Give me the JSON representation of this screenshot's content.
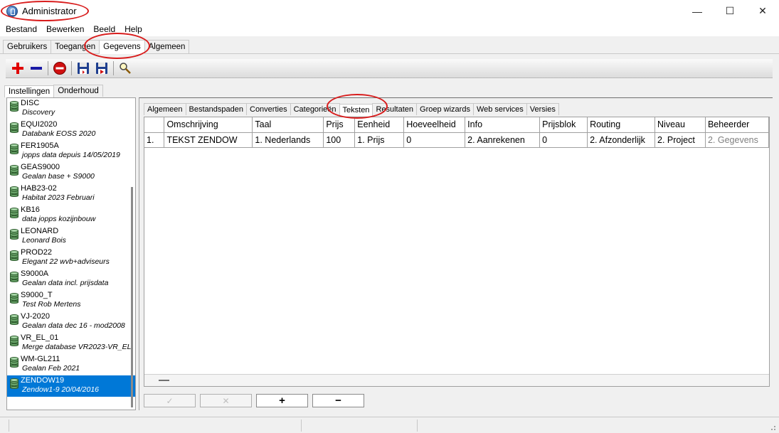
{
  "window": {
    "title": "Administrator",
    "controls": [
      "—",
      "☐",
      "✕"
    ]
  },
  "menu": [
    "Bestand",
    "Bewerken",
    "Beeld",
    "Help"
  ],
  "main_tabs": [
    {
      "label": "Gebruikers",
      "active": false
    },
    {
      "label": "Toegangen",
      "active": false
    },
    {
      "label": "Gegevens",
      "active": true
    },
    {
      "label": "Algemeen",
      "active": false
    }
  ],
  "toolbar": {
    "icons": [
      "add-icon",
      "remove-icon",
      "delete-icon",
      "save-icon",
      "save-as-icon",
      "search-icon"
    ],
    "colors": {
      "add": "#e00000",
      "remove": "#1a1aa6",
      "delete": "#d01010"
    }
  },
  "left_tabs": [
    {
      "label": "Instellingen",
      "active": true
    },
    {
      "label": "Onderhoud",
      "active": false
    }
  ],
  "databases": [
    {
      "name": "DISC",
      "desc": "Discovery"
    },
    {
      "name": "EQUI2020",
      "desc": "Databank EOSS 2020"
    },
    {
      "name": "FER1905A",
      "desc": "jopps data depuis 14/05/2019"
    },
    {
      "name": "GEAS9000",
      "desc": "Gealan base + S9000"
    },
    {
      "name": "HAB23-02",
      "desc": "Habitat 2023 Februari"
    },
    {
      "name": "KB16",
      "desc": "data jopps kozijnbouw"
    },
    {
      "name": "LEONARD",
      "desc": "Leonard Bois"
    },
    {
      "name": "PROD22",
      "desc": "Elegant 22 wvb+adviseurs"
    },
    {
      "name": "S9000A",
      "desc": "Gealan data incl. prijsdata"
    },
    {
      "name": "S9000_T",
      "desc": "Test Rob Mertens"
    },
    {
      "name": "VJ-2020",
      "desc": "Gealan data dec 16 - mod2008"
    },
    {
      "name": "VR_EL_01",
      "desc": "Merge database VR2023-VR_EL"
    },
    {
      "name": "WM-GL211",
      "desc": "Gealan Feb 2021"
    },
    {
      "name": "ZENDOW19",
      "desc": "Zendow1-9 20/04/2016",
      "selected": true
    }
  ],
  "sub_tabs": [
    {
      "label": "Algemeen",
      "active": false
    },
    {
      "label": "Bestandspaden",
      "active": false
    },
    {
      "label": "Converties",
      "active": false
    },
    {
      "label": "Categorieën",
      "active": false
    },
    {
      "label": "Teksten",
      "active": true
    },
    {
      "label": "Resultaten",
      "active": false
    },
    {
      "label": "Groep wizards",
      "active": false
    },
    {
      "label": "Web services",
      "active": false
    },
    {
      "label": "Versies",
      "active": false
    }
  ],
  "table": {
    "columns": [
      "",
      "Omschrijving",
      "Taal",
      "Prijs",
      "Eenheid",
      "Hoeveelheid",
      "Info",
      "Prijsblok",
      "Routing",
      "Niveau",
      "Beheerder"
    ],
    "rows": [
      [
        "1.",
        "TEKST ZENDOW",
        "1. Nederlands",
        "100",
        "1. Prijs",
        "0",
        "2. Aanrekenen",
        "0",
        "2. Afzonderlijk",
        "2. Project",
        "2. Gegevens"
      ]
    ]
  },
  "actions": [
    {
      "label": "✓",
      "enabled": false
    },
    {
      "label": "✕",
      "enabled": false
    },
    {
      "label": "+",
      "enabled": true
    },
    {
      "label": "−",
      "enabled": true
    }
  ],
  "annotation_color": "#d81c1c"
}
